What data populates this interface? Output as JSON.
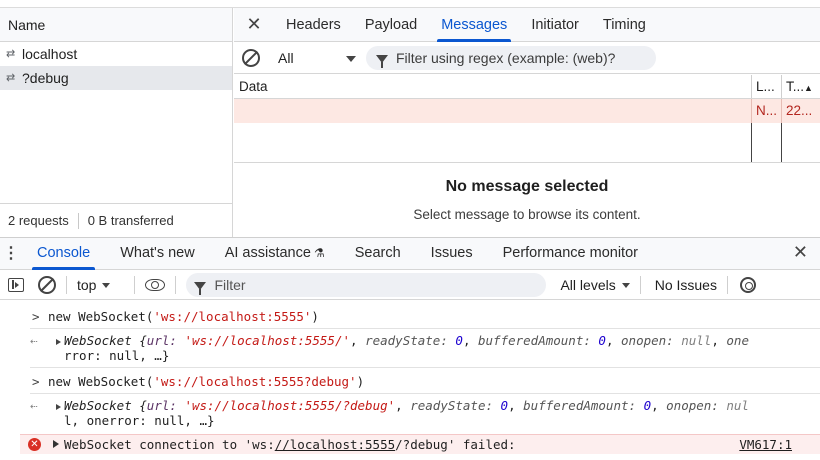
{
  "network": {
    "name_header": "Name",
    "requests": [
      {
        "label": "localhost",
        "selected": false
      },
      {
        "label": "?debug",
        "selected": true
      }
    ],
    "footer": {
      "requests": "2 requests",
      "transferred": "0 B transferred"
    }
  },
  "detail": {
    "tabs": [
      "Headers",
      "Payload",
      "Messages",
      "Initiator",
      "Timing"
    ],
    "active_tab": "Messages",
    "filter_select": "All",
    "regex_placeholder": "Filter using regex (example: (web)?",
    "columns": {
      "data": "Data",
      "length": "L...",
      "time": "T..."
    },
    "row": {
      "length": "N...",
      "time": "22..."
    },
    "empty_title": "No message selected",
    "empty_subtitle": "Select message to browse its content."
  },
  "drawer": {
    "tabs": [
      "Console",
      "What's new",
      "AI assistance",
      "Search",
      "Issues",
      "Performance monitor"
    ],
    "active_tab": "Console",
    "toolbar": {
      "context": "top",
      "filter_placeholder": "Filter",
      "levels": "All levels",
      "issues": "No Issues"
    }
  },
  "console": {
    "cmd1": {
      "fn": "new WebSocket(",
      "arg": "'ws://localhost:5555'",
      "close": ")"
    },
    "res1": {
      "line1_prefix": "WebSocket {",
      "url_key": "url:",
      "url_val": "'ws://localhost:5555/'",
      "ready_key": "readyState:",
      "ready_val": "0",
      "buf_key": "bufferedAmount:",
      "buf_val": "0",
      "onopen_key": "onopen:",
      "onopen_val": "null",
      "line1_tail": "one",
      "line2": "rror: null, …}"
    },
    "cmd2": {
      "fn": "new WebSocket(",
      "arg": "'ws://localhost:5555?debug'",
      "close": ")"
    },
    "res2": {
      "line1_prefix": "WebSocket {",
      "url_key": "url:",
      "url_val": "'ws://localhost:5555/?debug'",
      "ready_key": "readyState:",
      "ready_val": "0",
      "buf_key": "bufferedAmount:",
      "buf_val": "0",
      "onopen_key": "onopen:",
      "line1_tail": "nul",
      "line2": "l, onerror: null, …}"
    },
    "error": {
      "pre": "WebSocket connection to 'ws:",
      "link": "//localhost:5555",
      "post": "/?debug' failed:",
      "source": "VM617:1"
    }
  },
  "colors": {
    "accent": "#0b57d0",
    "error_bg": "#fdeeee",
    "selected_row_bg": "#fde8e3",
    "error_icon": "#d93025"
  }
}
